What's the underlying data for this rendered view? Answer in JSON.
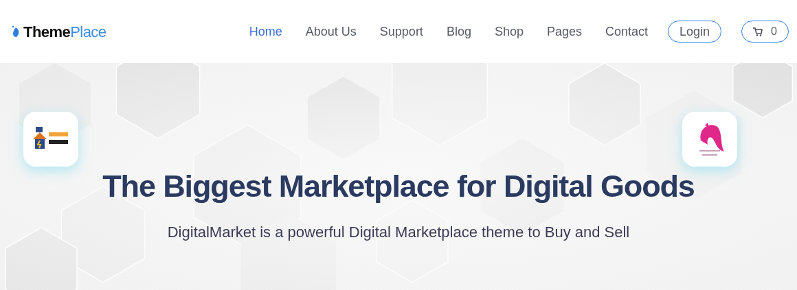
{
  "logo": {
    "text_main": "Theme",
    "text_accent": "Place"
  },
  "nav": [
    {
      "label": "Home",
      "selected": true
    },
    {
      "label": "About Us",
      "selected": false
    },
    {
      "label": "Support",
      "selected": false
    },
    {
      "label": "Blog",
      "selected": false
    },
    {
      "label": "Shop",
      "selected": false
    },
    {
      "label": "Pages",
      "selected": false
    },
    {
      "label": "Contact",
      "selected": false
    }
  ],
  "login_button": "Login",
  "cart": {
    "count": "0"
  },
  "hero": {
    "title": "The Biggest Marketplace for Digital Goods",
    "subtitle": "DigitalMarket is a powerful Digital Marketplace theme to Buy and Sell"
  }
}
